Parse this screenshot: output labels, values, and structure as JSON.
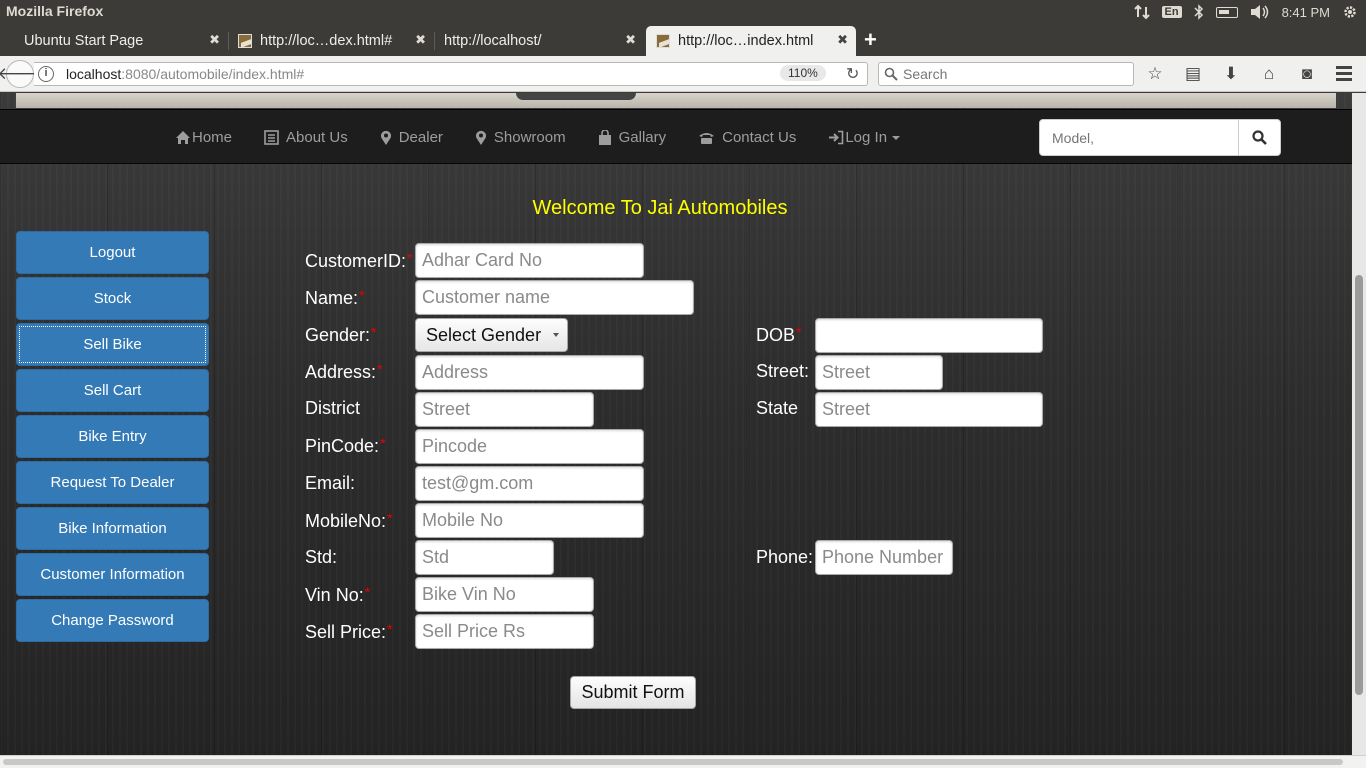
{
  "os": {
    "window_title": "Mozilla Firefox",
    "keyboard": "En",
    "clock": "8:41 PM"
  },
  "browser": {
    "tabs": [
      {
        "title": "Ubuntu Start Page"
      },
      {
        "title": "http://loc…dex.html#"
      },
      {
        "title": "http://localhost/"
      },
      {
        "title": "http://loc…index.html"
      }
    ],
    "new_tab": "+",
    "url_host": "localhost",
    "url_rest": ":8080/automobile/index.html#",
    "zoom": "110%",
    "search_placeholder": "Search"
  },
  "site": {
    "nav": [
      {
        "label": "Home"
      },
      {
        "label": "About Us"
      },
      {
        "label": "Dealer"
      },
      {
        "label": "Showroom"
      },
      {
        "label": "Gallary"
      },
      {
        "label": "Contact Us"
      },
      {
        "label": "Log In"
      }
    ],
    "search_placeholder": "Model,",
    "welcome": "Welcome To Jai Automobiles",
    "colors": {
      "welcome": "#ffff00",
      "sidebar_button": "#337ab7",
      "required_mark": "#ee0000"
    }
  },
  "sidebar": [
    {
      "label": "Logout"
    },
    {
      "label": "Stock"
    },
    {
      "label": "Sell Bike"
    },
    {
      "label": "Sell Cart"
    },
    {
      "label": "Bike Entry"
    },
    {
      "label": "Request To Dealer"
    },
    {
      "label": "Bike Information"
    },
    {
      "label": "Customer Information"
    },
    {
      "label": "Change Password"
    }
  ],
  "form": {
    "customer_id": {
      "label": "CustomerID:",
      "placeholder": "Adhar Card No"
    },
    "name": {
      "label": "Name:",
      "placeholder": "Customer name"
    },
    "gender": {
      "label": "Gender:",
      "selected": "Select Gender"
    },
    "dob": {
      "label": "DOB"
    },
    "address": {
      "label": "Address:",
      "placeholder": "Address"
    },
    "street": {
      "label": "Street:",
      "placeholder": "Street"
    },
    "district": {
      "label": "District",
      "placeholder": "Street"
    },
    "state": {
      "label": "State",
      "placeholder": "Street"
    },
    "pincode": {
      "label": "PinCode:",
      "placeholder": "Pincode"
    },
    "email": {
      "label": "Email:",
      "placeholder": "test@gm.com"
    },
    "mobile": {
      "label": "MobileNo:",
      "placeholder": "Mobile No"
    },
    "std": {
      "label": "Std:",
      "placeholder": "Std"
    },
    "phone": {
      "label": "Phone:",
      "placeholder": "Phone Number"
    },
    "vin": {
      "label": "Vin No:",
      "placeholder": "Bike Vin No"
    },
    "sell_price": {
      "label": "Sell Price:",
      "placeholder": "Sell Price Rs"
    },
    "required_mark": "*",
    "submit": "Submit Form"
  }
}
